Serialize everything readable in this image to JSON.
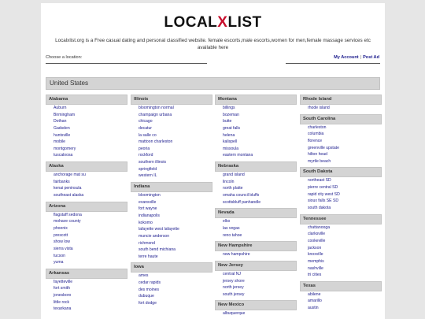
{
  "logo": {
    "part1": "LOCAL",
    "part2": "X",
    "part3": "LIST"
  },
  "tagline": "Localxlist.org is a Free casual dating and personal classified website. female escorts,male escorts,women for men,female massage services etc available here",
  "location": {
    "label": "Choose a location:"
  },
  "links": {
    "account": "My Account",
    "separator": "|",
    "post_ad": "Post Ad"
  },
  "country": "United States",
  "columns": [
    [
      {
        "state": "Alabama",
        "cities": [
          "Auburn",
          "Birmingham",
          "Dothan",
          "Gadsden",
          "huntsville",
          "mobile",
          "montgomery",
          "tuscaloosa"
        ]
      },
      {
        "state": "Alaska",
        "cities": [
          "anchorage mat su",
          "fairbanks",
          "kenai peninsula",
          "southeast alaska"
        ]
      },
      {
        "state": "Arizona",
        "cities": [
          "flagstaff sedona",
          "mohave county",
          "phoenix",
          "prescott",
          "show low",
          "sierra vista",
          "tucson",
          "yuma"
        ]
      },
      {
        "state": "Arkansas",
        "cities": [
          "fayetteville",
          "fort smith",
          "jonesboro",
          "little rock",
          "texarkana"
        ]
      }
    ],
    [
      {
        "state": "Illinois",
        "cities": [
          "bloomington normal",
          "champaign urbana",
          "chicago",
          "decatur",
          "la salle co",
          "mattoon charleston",
          "peoria",
          "rockford",
          "southern illinois",
          "springfield",
          "western IL"
        ]
      },
      {
        "state": "Indiana",
        "cities": [
          "bloomington",
          "evansville",
          "fort wayne",
          "indianapolis",
          "kokomo",
          "lafayette west lafayette",
          "muncie anderson",
          "richmond",
          "south bend michiana",
          "terre haute"
        ]
      },
      {
        "state": "Iowa",
        "cities": [
          "ames",
          "cedar rapids",
          "des moines",
          "dubuque",
          "fort dodge"
        ]
      }
    ],
    [
      {
        "state": "Montana",
        "cities": [
          "billings",
          "bozeman",
          "butte",
          "great falls",
          "helena",
          "kalispell",
          "missoula",
          "eastern montana"
        ]
      },
      {
        "state": "Nebraska",
        "cities": [
          "grand island",
          "lincoln",
          "north platte",
          "omaha council bluffs",
          "scottsbluff panhandle"
        ]
      },
      {
        "state": "Nevada",
        "cities": [
          "elko",
          "las vegas",
          "reno tahoe"
        ]
      },
      {
        "state": "New Hampshire",
        "cities": [
          "new hampshire"
        ]
      },
      {
        "state": "New Jersey",
        "cities": [
          "central NJ",
          "jersey shore",
          "north jersey",
          "south jersey"
        ]
      },
      {
        "state": "New Mexico",
        "cities": [
          "albuquerque"
        ]
      }
    ],
    [
      {
        "state": "Rhode Island",
        "cities": [
          "rhode island"
        ]
      },
      {
        "state": "South Carolina",
        "cities": [
          "charleston",
          "columbia",
          "florence",
          "greenville upstate",
          "hilton head",
          "myrtle beach"
        ]
      },
      {
        "state": "South Dakota",
        "cities": [
          "northeast SD",
          "pierre central SD",
          "rapid city west SD",
          "sioux falls SE SD",
          "south dakota"
        ]
      },
      {
        "state": "Tennessee",
        "cities": [
          "chattanooga",
          "clarksville",
          "cookeville",
          "jackson",
          "knoxville",
          "memphis",
          "nashville",
          "tri cities"
        ]
      },
      {
        "state": "Texas",
        "cities": [
          "abilene",
          "amarillo",
          "austin"
        ]
      }
    ]
  ]
}
